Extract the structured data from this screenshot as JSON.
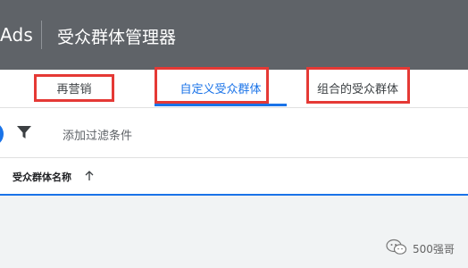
{
  "header": {
    "brand": "Ads",
    "title": "受众群体管理器"
  },
  "tabs": [
    {
      "label": "再营销",
      "active": false
    },
    {
      "label": "自定义受众群体",
      "active": true
    },
    {
      "label": "组合的受众群体",
      "active": false
    }
  ],
  "toolbar": {
    "filter_label": "添加过滤条件",
    "filter_icon": "filter-icon"
  },
  "table": {
    "columns": [
      {
        "label": "受众群体名称",
        "sort": "ascending"
      }
    ]
  },
  "watermark": {
    "text": "500强哥"
  },
  "colors": {
    "appbar": "#5f6368",
    "accent": "#1a73e8",
    "highlight": "#e53935"
  }
}
